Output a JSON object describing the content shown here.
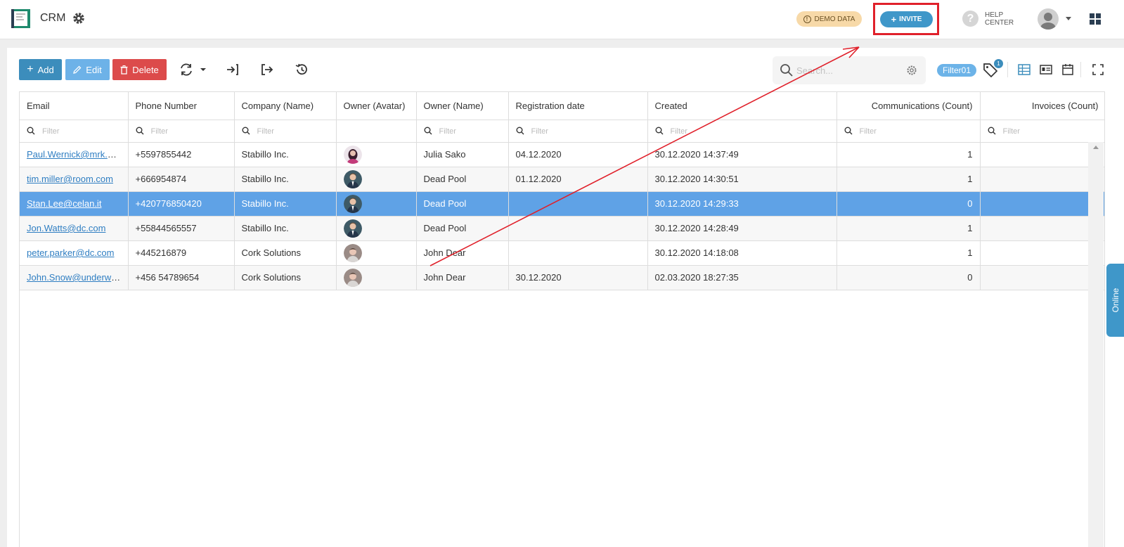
{
  "header": {
    "app_title": "CRM",
    "demo_label": "DEMO DATA",
    "invite_label": "INVITE",
    "help_line1": "HELP",
    "help_line2": "CENTER"
  },
  "toolbar": {
    "add_label": "Add",
    "edit_label": "Edit",
    "delete_label": "Delete",
    "search_placeholder": "Search...",
    "filter_chip": "Filter01",
    "tag_badge_count": "1"
  },
  "table": {
    "columns": [
      "Email",
      "Phone Number",
      "Company (Name)",
      "Owner (Avatar)",
      "Owner (Name)",
      "Registration date",
      "Created",
      "Communications (Count)",
      "Invoices (Count)"
    ],
    "filter_placeholder": "Filter",
    "rows": [
      {
        "email": "Paul.Wernick@mrk.com",
        "phone": "+5597855442",
        "company": "Stabillo Inc.",
        "owner": "Julia Sako",
        "reg": "04.12.2020",
        "created": "30.12.2020 14:37:49",
        "comms": "1",
        "invoices": "",
        "avatar": "female"
      },
      {
        "email": "tim.miller@room.com",
        "phone": "+666954874",
        "company": "Stabillo Inc.",
        "owner": "Dead Pool",
        "reg": "01.12.2020",
        "created": "30.12.2020 14:30:51",
        "comms": "1",
        "invoices": "",
        "avatar": "suit"
      },
      {
        "email": "Stan.Lee@celan.it",
        "phone": "+420776850420",
        "company": "Stabillo Inc.",
        "owner": "Dead Pool",
        "reg": "",
        "created": "30.12.2020 14:29:33",
        "comms": "0",
        "invoices": "",
        "avatar": "suit"
      },
      {
        "email": "Jon.Watts@dc.com",
        "phone": "+55844565557",
        "company": "Stabillo Inc.",
        "owner": "Dead Pool",
        "reg": "",
        "created": "30.12.2020 14:28:49",
        "comms": "1",
        "invoices": "",
        "avatar": "suit"
      },
      {
        "email": "peter.parker@dc.com",
        "phone": "+445216879",
        "company": "Cork Solutions",
        "owner": "John Dear",
        "reg": "",
        "created": "30.12.2020 14:18:08",
        "comms": "1",
        "invoices": "",
        "avatar": "male"
      },
      {
        "email": "John.Snow@underworld.com",
        "phone": "+456 54789654",
        "company": "Cork Solutions",
        "owner": "John Dear",
        "reg": "30.12.2020",
        "created": "02.03.2020 18:27:35",
        "comms": "0",
        "invoices": "",
        "avatar": "male"
      }
    ]
  },
  "online_tab": "Online",
  "colors": {
    "primary": "#3c8dbc",
    "edit": "#6db2e8",
    "delete": "#dc4b4b",
    "selected_row": "#5fa2e6",
    "highlight": "#e0202a",
    "demo_badge": "#f7d9a8"
  },
  "icons": [
    "crm-logo-icon",
    "gear-icon",
    "info-icon",
    "plus-icon",
    "help-icon",
    "user-avatar-icon",
    "apps-grid-icon",
    "pencil-icon",
    "trash-icon",
    "refresh-icon",
    "import-icon",
    "export-icon",
    "history-icon",
    "search-icon",
    "search-settings-icon",
    "tag-icon",
    "table-view-icon",
    "card-view-icon",
    "calendar-view-icon",
    "fullscreen-icon",
    "filter-search-icon"
  ]
}
